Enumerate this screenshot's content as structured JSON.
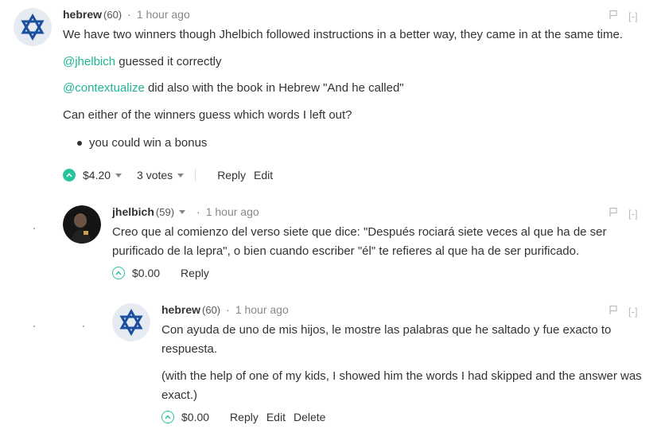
{
  "comments": [
    {
      "author": "hebrew",
      "reputation": "(60)",
      "separator": "·",
      "time": "1 hour ago",
      "collapse": "[-]",
      "paragraphs": [
        "We have two winners though Jhelbich followed instructions in a better way, they came in at the same time."
      ],
      "mention1": "@jhelbich",
      "mention1_rest": " guessed it correctly",
      "mention2": "@contextualize",
      "mention2_rest": " did also with the book in Hebrew \"And he called\"",
      "question": "Can either of the winners guess which words I left out?",
      "bullet": "you could win a bonus",
      "payout": "$4.20",
      "votes": "3 votes",
      "actions": [
        "Reply",
        "Edit"
      ]
    },
    {
      "author": "jhelbich",
      "reputation": "(59)",
      "separator": "·",
      "time": "1 hour ago",
      "collapse": "[-]",
      "text": "Creo que al comienzo del verso siete que dice: \"Después rociará siete veces al que ha de ser purificado de la lepra\", o bien cuando escriber \"él\" te refieres al que ha de ser purificado.",
      "payout": "$0.00",
      "actions": [
        "Reply"
      ]
    },
    {
      "author": "hebrew",
      "reputation": "(60)",
      "separator": "·",
      "time": "1 hour ago",
      "collapse": "[-]",
      "text1": "Con ayuda de uno de mis hijos, le mostre las palabras que he saltado y fue exacto to respuesta.",
      "text2": "(with the help of one of my kids, I showed him the words I had skipped and the answer was exact.)",
      "payout": "$0.00",
      "actions": [
        "Reply",
        "Edit",
        "Delete"
      ]
    }
  ],
  "colors": {
    "accent": "#1fb593",
    "vote": "#28c4a0"
  },
  "icons": {
    "flag": "flag-icon",
    "upvote": "upvote-icon",
    "dropdown": "chevron-down-icon"
  }
}
